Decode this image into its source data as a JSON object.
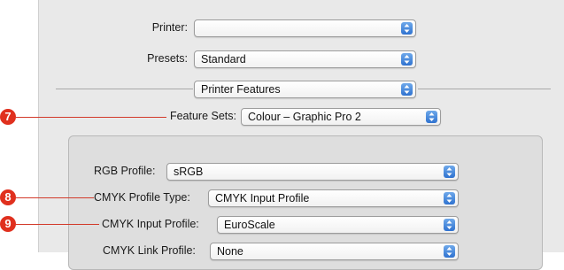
{
  "printer": {
    "label": "Printer:",
    "value": ""
  },
  "presets": {
    "label": "Presets:",
    "value": "Standard"
  },
  "panel_menu": {
    "value": "Printer Features"
  },
  "feature_sets": {
    "label": "Feature Sets:",
    "value": "Colour – Graphic Pro 2"
  },
  "rgb_profile": {
    "label": "RGB Profile:",
    "value": "sRGB"
  },
  "cmyk_profile_type": {
    "label": "CMYK Profile Type:",
    "value": "CMYK Input Profile"
  },
  "cmyk_input_profile": {
    "label": "CMYK Input Profile:",
    "value": "EuroScale"
  },
  "cmyk_link_profile": {
    "label": "CMYK Link Profile:",
    "value": "None"
  },
  "callouts": [
    "7",
    "8",
    "9"
  ],
  "colors": {
    "callout": "#e0301e",
    "arrow_button": "#3a7ad6"
  }
}
